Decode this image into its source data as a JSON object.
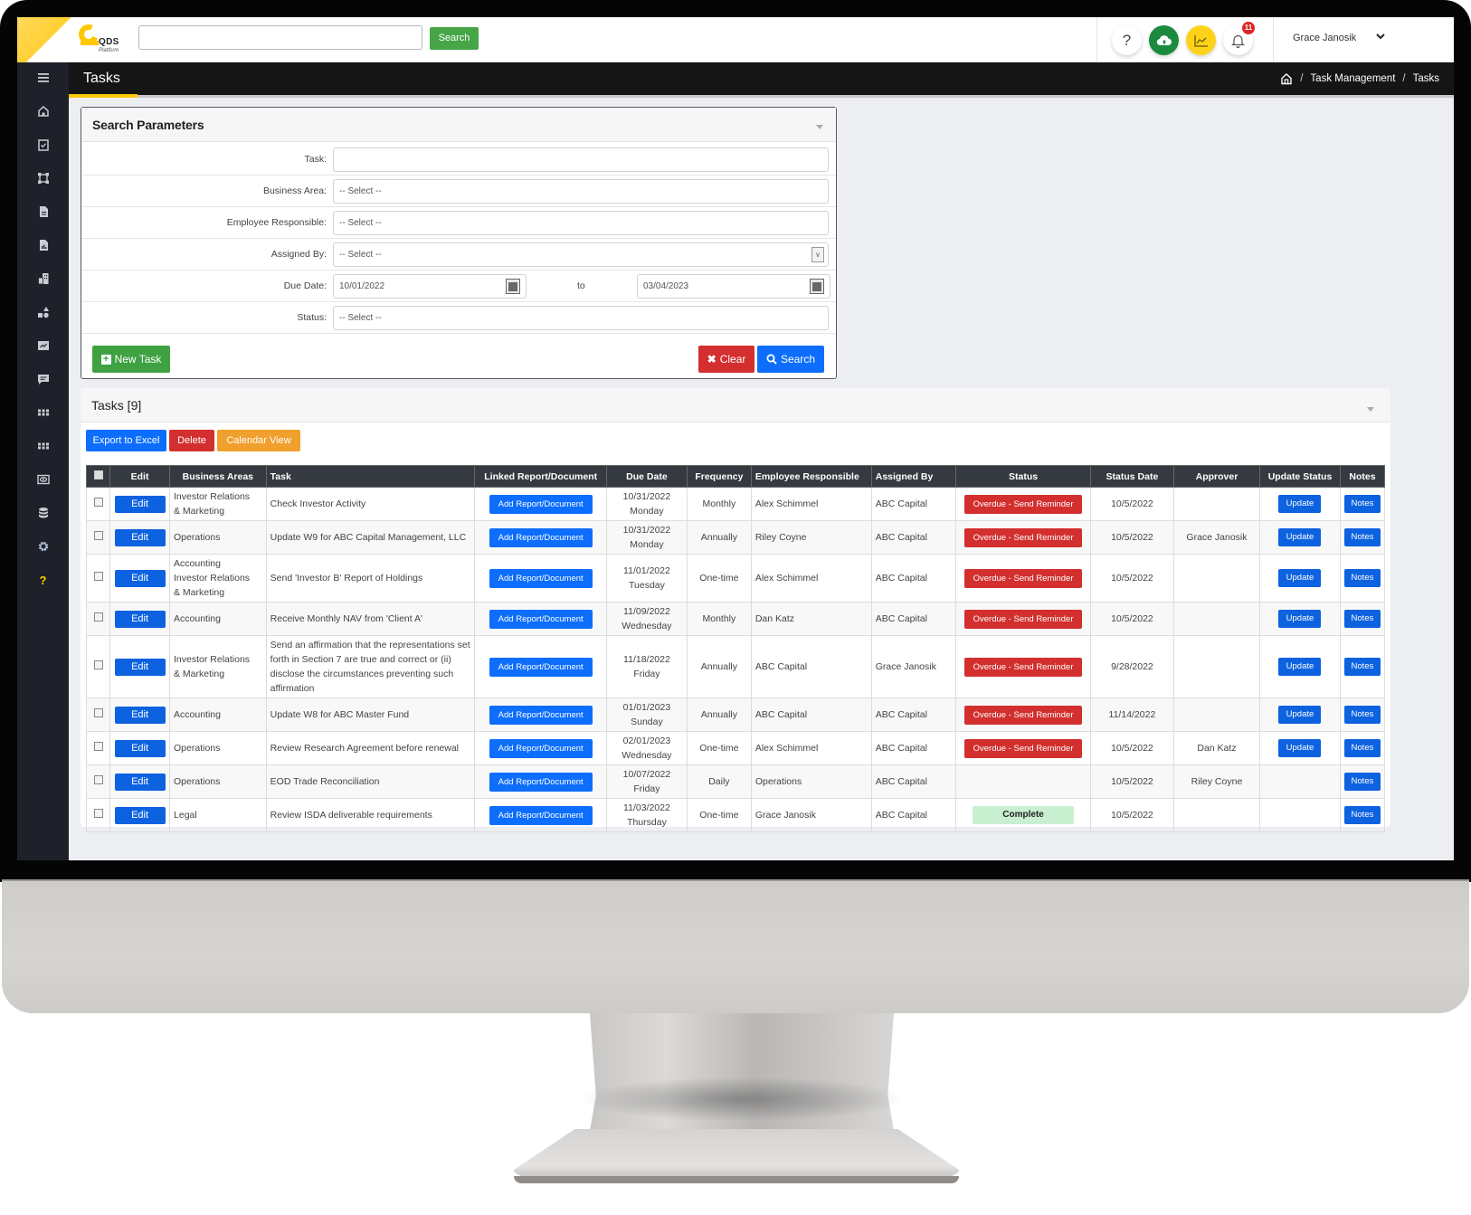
{
  "app": {
    "logo_text": "QDS",
    "logo_subtext": "Platform",
    "top_search": {
      "placeholder": "",
      "value": "",
      "button_label": "Search"
    },
    "notification_count": "11",
    "user_name": "Grace Janosik",
    "icons": [
      "help-icon",
      "cloud-upload-icon",
      "chart-icon",
      "bell-icon",
      "chevron-down-icon"
    ]
  },
  "colors": {
    "brand_yellow": "#ffc700",
    "primary_blue": "#0d6efd",
    "success_green": "#3fa142",
    "danger_red": "#d32f2f",
    "warning_orange": "#f0a02c",
    "complete_green_bg": "#c8f0d0",
    "sidebar_bg": "#1e2129",
    "header_bg": "#151515"
  },
  "sidebar": {
    "items": [
      {
        "name": "menu",
        "icon": "hamburger-icon"
      },
      {
        "name": "home",
        "icon": "home-icon"
      },
      {
        "name": "tasks",
        "icon": "clipboard-check-icon"
      },
      {
        "name": "frame",
        "icon": "frame-icon"
      },
      {
        "name": "documents",
        "icon": "document-icon"
      },
      {
        "name": "reports",
        "icon": "report-file-icon"
      },
      {
        "name": "buildings",
        "icon": "building-icon"
      },
      {
        "name": "shapes",
        "icon": "shapes-icon"
      },
      {
        "name": "analytics",
        "icon": "chart-box-icon"
      },
      {
        "name": "messages",
        "icon": "message-icon"
      },
      {
        "name": "apps-1",
        "icon": "grid-icon"
      },
      {
        "name": "apps-2",
        "icon": "grid-icon"
      },
      {
        "name": "view",
        "icon": "eye-icon"
      },
      {
        "name": "database",
        "icon": "database-icon"
      },
      {
        "name": "settings",
        "icon": "gear-icon"
      },
      {
        "name": "help",
        "icon": "question-icon"
      }
    ]
  },
  "page": {
    "title": "Tasks",
    "breadcrumb": [
      "Task Management",
      "Tasks"
    ]
  },
  "search_params": {
    "title": "Search Parameters",
    "fields": {
      "task": {
        "label": "Task:",
        "value": ""
      },
      "business_area": {
        "label": "Business Area:",
        "value": "-- Select --"
      },
      "employee_responsible": {
        "label": "Employee Responsible:",
        "value": "-- Select --"
      },
      "assigned_by": {
        "label": "Assigned By:",
        "value": "-- Select --"
      },
      "due_date": {
        "label": "Due Date:",
        "from": "10/01/2022",
        "to_label": "to",
        "to": "03/04/2023"
      },
      "status": {
        "label": "Status:",
        "value": "-- Select --"
      }
    },
    "buttons": {
      "new_task": "New Task",
      "clear": "Clear",
      "search": "Search"
    }
  },
  "tasks": {
    "title": "Tasks [9]",
    "toolbar": {
      "export": "Export to Excel",
      "delete": "Delete",
      "calendar": "Calendar View"
    },
    "columns": [
      "",
      "Edit",
      "Business Areas",
      "Task",
      "Linked Report/Document",
      "Due Date",
      "Frequency",
      "Employee Responsible",
      "Assigned By",
      "Status",
      "Status Date",
      "Approver",
      "Update Status",
      "Notes"
    ],
    "button_labels": {
      "edit": "Edit",
      "add_report": "Add Report/Document",
      "update": "Update",
      "notes": "Notes"
    },
    "rows": [
      {
        "business_areas": [
          "Investor Relations",
          "& Marketing"
        ],
        "task": "Check Investor Activity",
        "due_date": "10/31/2022",
        "due_day": "Monday",
        "frequency": "Monthly",
        "employee": "Alex Schimmel",
        "assigned_by": "ABC Capital",
        "status": "Overdue - Send Reminder",
        "status_type": "overdue",
        "status_date": "10/5/2022",
        "approver": "",
        "has_update": true
      },
      {
        "business_areas": [
          "Operations"
        ],
        "task": "Update W9 for ABC Capital Management, LLC",
        "due_date": "10/31/2022",
        "due_day": "Monday",
        "frequency": "Annually",
        "employee": "Riley Coyne",
        "assigned_by": "ABC Capital",
        "status": "Overdue - Send Reminder",
        "status_type": "overdue",
        "status_date": "10/5/2022",
        "approver": "Grace Janosik",
        "has_update": true
      },
      {
        "business_areas": [
          "Accounting",
          "Investor Relations",
          "& Marketing"
        ],
        "task": "Send 'Investor B' Report of Holdings",
        "due_date": "11/01/2022",
        "due_day": "Tuesday",
        "frequency": "One-time",
        "employee": "Alex Schimmel",
        "assigned_by": "ABC Capital",
        "status": "Overdue - Send Reminder",
        "status_type": "overdue",
        "status_date": "10/5/2022",
        "approver": "",
        "has_update": true
      },
      {
        "business_areas": [
          "Accounting"
        ],
        "task": "Receive Monthly NAV from 'Client A'",
        "due_date": "11/09/2022",
        "due_day": "Wednesday",
        "frequency": "Monthly",
        "employee": "Dan Katz",
        "assigned_by": "ABC Capital",
        "status": "Overdue - Send Reminder",
        "status_type": "overdue",
        "status_date": "10/5/2022",
        "approver": "",
        "has_update": true
      },
      {
        "business_areas": [
          "Investor Relations",
          "& Marketing"
        ],
        "task": "Send an affirmation that the representations set forth in Section 7 are true and correct or (ii) disclose the circumstances preventing such affirmation",
        "due_date": "11/18/2022",
        "due_day": "Friday",
        "frequency": "Annually",
        "employee": "ABC Capital",
        "assigned_by": "Grace Janosik",
        "status": "Overdue - Send Reminder",
        "status_type": "overdue",
        "status_date": "9/28/2022",
        "approver": "",
        "has_update": true
      },
      {
        "business_areas": [
          "Accounting"
        ],
        "task": "Update W8 for ABC Master Fund",
        "due_date": "01/01/2023",
        "due_day": "Sunday",
        "frequency": "Annually",
        "employee": "ABC Capital",
        "assigned_by": "ABC Capital",
        "status": "Overdue - Send Reminder",
        "status_type": "overdue",
        "status_date": "11/14/2022",
        "approver": "",
        "has_update": true
      },
      {
        "business_areas": [
          "Operations"
        ],
        "task": "Review Research Agreement before renewal",
        "due_date": "02/01/2023",
        "due_day": "Wednesday",
        "frequency": "One-time",
        "employee": "Alex Schimmel",
        "assigned_by": "ABC Capital",
        "status": "Overdue - Send Reminder",
        "status_type": "overdue",
        "status_date": "10/5/2022",
        "approver": "Dan Katz",
        "has_update": true
      },
      {
        "business_areas": [
          "Operations"
        ],
        "task": "EOD Trade Reconciliation",
        "due_date": "10/07/2022",
        "due_day": "Friday",
        "frequency": "Daily",
        "employee": "Operations",
        "assigned_by": "ABC Capital",
        "status": "",
        "status_type": "none",
        "status_date": "10/5/2022",
        "approver": "Riley Coyne",
        "has_update": false
      },
      {
        "business_areas": [
          "Legal"
        ],
        "task": "Review ISDA deliverable requirements",
        "due_date": "11/03/2022",
        "due_day": "Thursday",
        "frequency": "One-time",
        "employee": "Grace Janosik",
        "assigned_by": "ABC Capital",
        "status": "Complete",
        "status_type": "complete",
        "status_date": "10/5/2022",
        "approver": "",
        "has_update": false
      }
    ]
  }
}
